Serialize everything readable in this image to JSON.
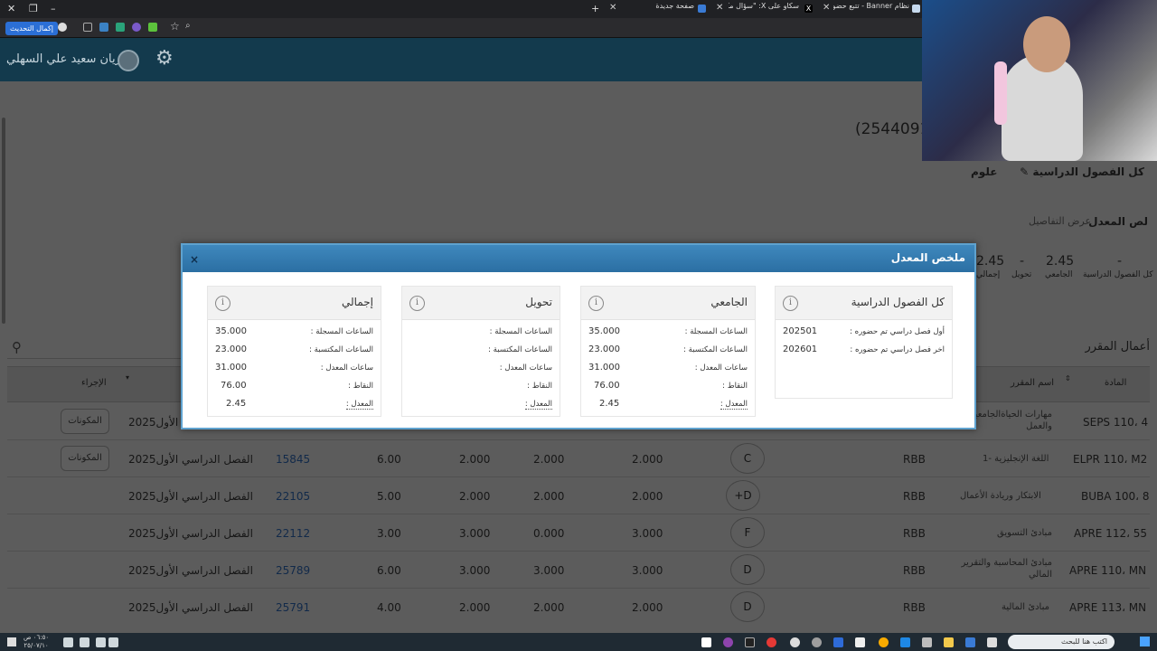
{
  "browser": {
    "tabs": [
      {
        "label": "نظام Banner - تتبع حضور الطلاب"
      },
      {
        "label": "سكاو على X: \"سؤال مكرر\" ماذا"
      },
      {
        "label": "صفحة جديدة"
      }
    ],
    "new_tab": "+",
    "update_button": "إكمال التحديث"
  },
  "header": {
    "user_name": "ريان سعيد علي السهلي",
    "student_id": "(2544091"
  },
  "page": {
    "nav_semesters": "كل الفصول الدراسية",
    "nav_log": "علوم",
    "gpa_section_title": "لص المعدل",
    "gpa_details_link": "عرض التفاصيل",
    "gpa_summary": [
      {
        "value": "-",
        "label": "كل الفصول الدراسية"
      },
      {
        "value": "2.45",
        "label": "الجامعي"
      },
      {
        "value": "-",
        "label": "تحويل"
      },
      {
        "value": "2.45",
        "label": "إجمالي"
      }
    ],
    "course_work_title": "أعمال المقرر",
    "table_headers": {
      "subject": "المادة",
      "course_name": "اسم المقرر",
      "action": "الإجراء"
    },
    "rows": [
      {
        "subject": "SEPS 110، 4",
        "name": "مهارات الحياةالجامعية والعمل",
        "campus": "",
        "grade": "",
        "h1": "",
        "h2": "",
        "h3": "",
        "points": "",
        "crn": "",
        "term": "الفصل الدراسي الأول2025",
        "button": "المكونات"
      },
      {
        "subject": "ELPR 110، M2",
        "name": "اللغة الإنجليزية -1",
        "campus": "RBB",
        "grade": "C",
        "h1": "2.000",
        "h2": "2.000",
        "h3": "2.000",
        "points": "6.00",
        "crn": "15845",
        "term": "الفصل الدراسي الأول2025",
        "button": "المكونات"
      },
      {
        "subject": "BUBA 100، 8",
        "name": "الابتكار وريادة الأعمال",
        "campus": "RBB",
        "grade": "+D",
        "h1": "2.000",
        "h2": "2.000",
        "h3": "2.000",
        "points": "5.00",
        "crn": "22105",
        "term": "الفصل الدراسي الأول2025",
        "button": ""
      },
      {
        "subject": "APRE 112، 55",
        "name": "مبادئ التسويق",
        "campus": "RBB",
        "grade": "F",
        "h1": "3.000",
        "h2": "0.000",
        "h3": "3.000",
        "points": "3.00",
        "crn": "22112",
        "term": "الفصل الدراسي الأول2025",
        "button": ""
      },
      {
        "subject": "APRE 110، MN",
        "name": "مبادئ المحاسبة والتقرير المالي",
        "campus": "RBB",
        "grade": "D",
        "h1": "3.000",
        "h2": "3.000",
        "h3": "3.000",
        "points": "6.00",
        "crn": "25789",
        "term": "الفصل الدراسي الأول2025",
        "button": ""
      },
      {
        "subject": "APRE 113، MN",
        "name": "مبادئ المالية",
        "campus": "RBB",
        "grade": "D",
        "h1": "2.000",
        "h2": "2.000",
        "h3": "2.000",
        "points": "4.00",
        "crn": "25791",
        "term": "الفصل الدراسي الأول2025",
        "button": ""
      }
    ]
  },
  "modal": {
    "title": "ملخص المعدل",
    "close": "×",
    "info_glyph": "i",
    "cards": [
      {
        "title": "كل الفصول الدراسية",
        "rows": [
          {
            "label": "أول فصل دراسي تم حضوره :",
            "value": "202501"
          },
          {
            "label": "اخر فصل دراسي تم حضوره :",
            "value": "202601"
          }
        ]
      },
      {
        "title": "الجامعي",
        "rows": [
          {
            "label": "الساعات المسجلة :",
            "value": "35.000"
          },
          {
            "label": "الساعات المكتسبة :",
            "value": "23.000"
          },
          {
            "label": "ساعات المعدل :",
            "value": "31.000"
          },
          {
            "label": "النقاط :",
            "value": "76.00"
          },
          {
            "label": "المعدل :",
            "value": "2.45"
          }
        ]
      },
      {
        "title": "تحويل",
        "rows": [
          {
            "label": "الساعات المسجلة :",
            "value": ""
          },
          {
            "label": "الساعات المكتسبة :",
            "value": ""
          },
          {
            "label": "ساعات المعدل :",
            "value": ""
          },
          {
            "label": "النقاط :",
            "value": ""
          },
          {
            "label": "المعدل :",
            "value": ""
          }
        ]
      },
      {
        "title": "إجمالي",
        "rows": [
          {
            "label": "الساعات المسجلة :",
            "value": "35.000"
          },
          {
            "label": "الساعات المكتسبة :",
            "value": "23.000"
          },
          {
            "label": "ساعات المعدل :",
            "value": "31.000"
          },
          {
            "label": "النقاط :",
            "value": "76.00"
          },
          {
            "label": "المعدل :",
            "value": "2.45"
          }
        ]
      }
    ]
  },
  "taskbar": {
    "search_placeholder": "اكتب هنا للبحث",
    "clock_time": "٠٦:٥٠ ص",
    "clock_date": "٢٥/٠٧/١٠"
  },
  "colors": {
    "modal_header": "#2b6fa3",
    "topbar": "#133a4d"
  }
}
